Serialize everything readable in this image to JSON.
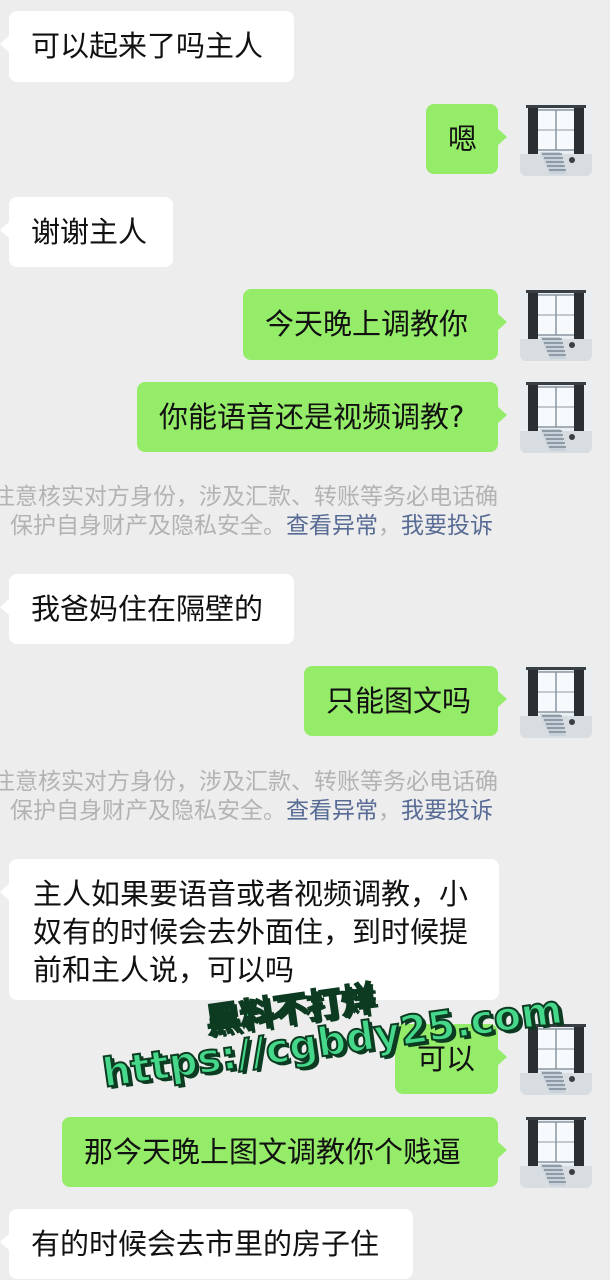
{
  "messages": [
    {
      "side": "left",
      "text": "可以起来了吗主人"
    },
    {
      "side": "right",
      "text": "嗯"
    },
    {
      "side": "left",
      "text": "谢谢主人"
    },
    {
      "side": "right",
      "text": "今天晚上调教你"
    },
    {
      "side": "right",
      "text": "你能语音还是视频调教?"
    },
    {
      "side": "left",
      "text": "我爸妈住在隔壁的"
    },
    {
      "side": "right",
      "text": "只能图文吗"
    },
    {
      "side": "left",
      "text": "主人如果要语音或者视频调教，小奴有的时候会去外面住，到时候提前和主人说，可以吗"
    },
    {
      "side": "right",
      "text": "可以"
    },
    {
      "side": "right",
      "text": "那今天晚上图文调教你个贱逼"
    },
    {
      "side": "left",
      "text": "有的时候会去市里的房子住"
    }
  ],
  "notices": [
    {
      "line1": "注意核实对方身份，涉及汇款、转账等务必电话确",
      "line2": "保护自身财产及隐私安全。",
      "link_check": "查看异常",
      "separator": "，",
      "link_report": "我要投诉"
    },
    {
      "line1": "注意核实对方身份，涉及汇款、转账等务必电话确",
      "line2": "保护自身财产及隐私安全。",
      "link_check": "查看异常",
      "separator": "，",
      "link_report": "我要投诉"
    }
  ],
  "watermark": {
    "line1": "黑料不打烊",
    "line2": "https://cgbdy25.com"
  },
  "colors": {
    "background": "#ededed",
    "incoming_bubble": "#ffffff",
    "outgoing_bubble": "#95ec69",
    "link": "#576b95",
    "system_text": "#b3b3b3"
  },
  "avatar_icon": "window-curtain-avatar-icon"
}
